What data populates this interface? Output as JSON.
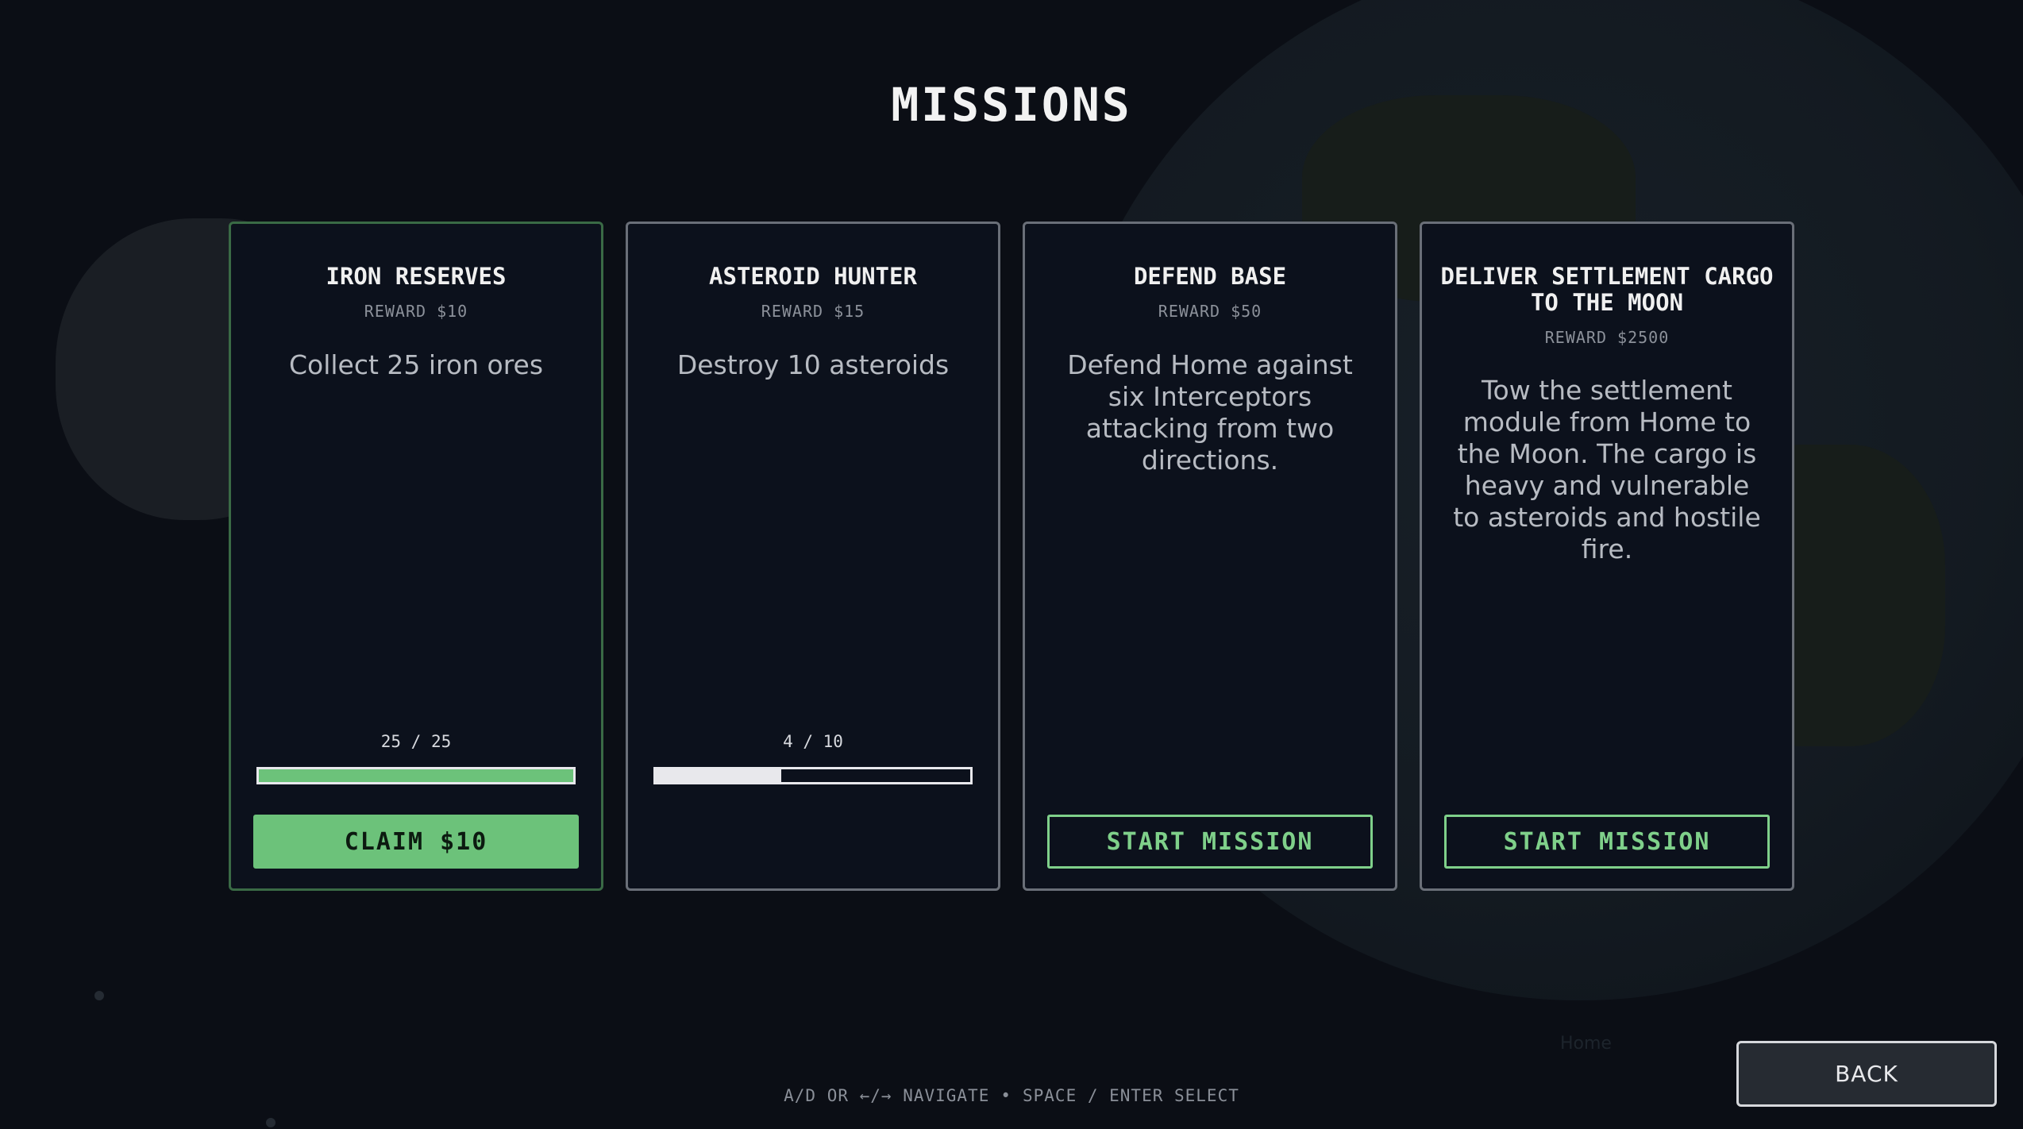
{
  "screen": {
    "title": "MISSIONS",
    "background_label": "Home"
  },
  "colors": {
    "accent_green": "#7fd08a",
    "claim_green": "#6cc27a",
    "complete_border": "#3a6a45",
    "card_border": "#6a6f78",
    "progress_white": "#e8e8ec"
  },
  "missions": [
    {
      "title": "IRON RESERVES",
      "reward": "REWARD $10",
      "description": "Collect 25 iron ores",
      "progress_text": "25 / 25",
      "progress": 1.0,
      "status": "complete",
      "button_label": "CLAIM $10"
    },
    {
      "title": "ASTEROID HUNTER",
      "reward": "REWARD $15",
      "description": "Destroy 10 asteroids",
      "progress_text": "4 / 10",
      "progress": 0.4,
      "status": "in-progress"
    },
    {
      "title": "DEFEND BASE",
      "reward": "REWARD $50",
      "description": "Defend Home against six Interceptors attacking from two directions.",
      "status": "available",
      "button_label": "START MISSION"
    },
    {
      "title": "DELIVER SETTLEMENT CARGO TO THE MOON",
      "reward": "REWARD $2500",
      "description": "Tow the settlement module from Home to the Moon. The cargo is heavy and vulnerable to asteroids and hostile fire.",
      "status": "available",
      "button_label": "START MISSION"
    }
  ],
  "footer": {
    "hint_navigate": "A/D OR ←/→ NAVIGATE",
    "hint_separator": "•",
    "hint_select": "SPACE / ENTER SELECT",
    "back_label": "BACK"
  }
}
